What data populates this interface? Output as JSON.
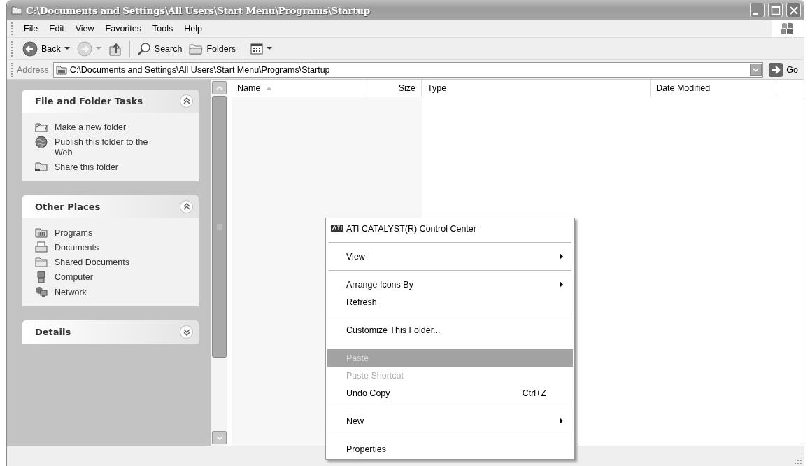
{
  "window": {
    "title": "C:\\Documents and Settings\\All Users\\Start Menu\\Programs\\Startup"
  },
  "menu_bar": [
    "File",
    "Edit",
    "View",
    "Favorites",
    "Tools",
    "Help"
  ],
  "toolbar": [
    {
      "kind": "back",
      "label": "Back",
      "disabled": false
    },
    {
      "kind": "forward",
      "disabled": true
    },
    {
      "kind": "up",
      "disabled": false
    },
    {
      "kind": "search",
      "label": "Search",
      "disabled": false
    },
    {
      "kind": "folders",
      "label": "Folders",
      "disabled": false
    },
    {
      "kind": "views",
      "disabled": false
    }
  ],
  "address_bar": {
    "label": "Address",
    "value": "C:\\Documents and Settings\\All Users\\Start Menu\\Programs\\Startup",
    "go": "Go"
  },
  "sidebar": {
    "panels": [
      {
        "title": "File and Folder Tasks",
        "expanded": true,
        "items": [
          "Make a new folder",
          "Publish this folder to the Web",
          "Share this folder"
        ]
      },
      {
        "title": "Other Places",
        "expanded": true,
        "items": [
          "Programs",
          "Documents",
          "Shared Documents",
          "Computer",
          "Network"
        ]
      },
      {
        "title": "Details",
        "expanded": false
      }
    ]
  },
  "file_list": {
    "columns": [
      {
        "label": "Name",
        "sorted": true
      },
      {
        "label": "Size",
        "sorted": false
      },
      {
        "label": "Type",
        "sorted": false
      },
      {
        "label": "Date Modified",
        "sorted": false
      }
    ]
  },
  "context_menu": [
    {
      "kind": "item",
      "label": "ATI CATALYST(R) Control Center",
      "icon": true,
      "submenu": false,
      "disabled": false,
      "selected": false
    },
    {
      "kind": "separator"
    },
    {
      "kind": "item",
      "label": "View",
      "submenu": true,
      "disabled": false,
      "selected": false
    },
    {
      "kind": "separator"
    },
    {
      "kind": "item",
      "label": "Arrange Icons By",
      "submenu": true,
      "disabled": false,
      "selected": false
    },
    {
      "kind": "item",
      "label": "Refresh",
      "submenu": false,
      "disabled": false,
      "selected": false
    },
    {
      "kind": "separator"
    },
    {
      "kind": "item",
      "label": "Customize This Folder...",
      "submenu": false,
      "disabled": false,
      "selected": false
    },
    {
      "kind": "separator"
    },
    {
      "kind": "item",
      "label": "Paste",
      "submenu": false,
      "disabled": true,
      "selected": true
    },
    {
      "kind": "item",
      "label": "Paste Shortcut",
      "submenu": false,
      "disabled": true,
      "selected": false
    },
    {
      "kind": "item",
      "label": "Undo Copy",
      "shortcut": "Ctrl+Z",
      "submenu": false,
      "disabled": false,
      "selected": false
    },
    {
      "kind": "separator"
    },
    {
      "kind": "item",
      "label": "New",
      "submenu": true,
      "disabled": false,
      "selected": false
    },
    {
      "kind": "separator"
    },
    {
      "kind": "item",
      "label": "Properties",
      "submenu": false,
      "disabled": false,
      "selected": false
    }
  ]
}
